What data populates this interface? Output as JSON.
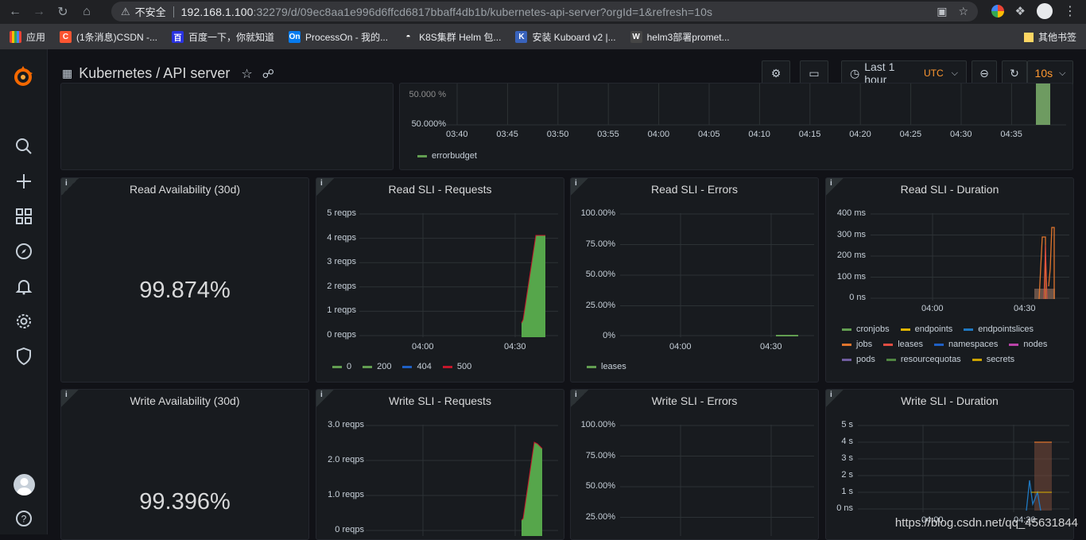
{
  "browser": {
    "insecure_label": "不安全",
    "url_host": "192.168.1.100",
    "url_rest": ":32279/d/09ec8aa1e996d6ffcd6817bbaff4db1b/kubernetes-api-server?orgId=1&refresh=10s",
    "bookmarks": [
      {
        "label": "应用",
        "icon": "apps-grid-icon",
        "color": "#ea4335"
      },
      {
        "label": "(1条消息)CSDN -...",
        "icon": "csdn-icon",
        "color": "#fc5531",
        "glyph": "C"
      },
      {
        "label": "百度一下，你就知道",
        "icon": "baidu-icon",
        "color": "#2932e1",
        "glyph": "百"
      },
      {
        "label": "ProcessOn - 我的...",
        "icon": "processon-icon",
        "color": "#067bef",
        "glyph": "On"
      },
      {
        "label": "K8S集群 Helm 包...",
        "icon": "github-icon",
        "color": "#35363a",
        "glyph": "◓"
      },
      {
        "label": "安装 Kuboard v2 |...",
        "icon": "kuboard-icon",
        "color": "#3963bc",
        "glyph": "K"
      },
      {
        "label": "helm3部署promet...",
        "icon": "wordpress-icon",
        "color": "#464646",
        "glyph": "W"
      }
    ],
    "other_bookmarks": "其他书签"
  },
  "dashboard": {
    "title": "Kubernetes / API server",
    "time_range": "Last 1 hour",
    "timezone": "UTC",
    "refresh": "10s"
  },
  "panels": {
    "errorbudget": {
      "ytick": "50.000%",
      "ytick_partial": "50.000 %",
      "xticks": [
        "03:40",
        "03:45",
        "03:50",
        "03:55",
        "04:00",
        "04:05",
        "04:10",
        "04:15",
        "04:20",
        "04:25",
        "04:30",
        "04:35"
      ],
      "legend": [
        {
          "name": "errorbudget",
          "color": "#629e51"
        }
      ]
    },
    "read_availability": {
      "title": "Read Availability (30d)",
      "value": "99.874%"
    },
    "write_availability": {
      "title": "Write Availability (30d)",
      "value": "99.396%"
    },
    "read_requests": {
      "title": "Read SLI - Requests",
      "yticks": [
        "5 reqps",
        "4 reqps",
        "3 reqps",
        "2 reqps",
        "1 reqps",
        "0 reqps"
      ],
      "xticks": [
        "04:00",
        "04:30"
      ],
      "legend": [
        {
          "name": "0",
          "color": "#629e51"
        },
        {
          "name": "200",
          "color": "#629e51"
        },
        {
          "name": "404",
          "color": "#1f60c4"
        },
        {
          "name": "500",
          "color": "#c4162a"
        }
      ]
    },
    "read_errors": {
      "title": "Read SLI - Errors",
      "yticks": [
        "100.00%",
        "75.00%",
        "50.00%",
        "25.00%",
        "0%"
      ],
      "xticks": [
        "04:00",
        "04:30"
      ],
      "legend": [
        {
          "name": "leases",
          "color": "#629e51"
        }
      ]
    },
    "read_duration": {
      "title": "Read SLI - Duration",
      "yticks": [
        "400 ms",
        "300 ms",
        "200 ms",
        "100 ms",
        "0 ns"
      ],
      "xticks": [
        "04:00",
        "04:30"
      ],
      "legend": [
        {
          "name": "cronjobs",
          "color": "#629e51"
        },
        {
          "name": "endpoints",
          "color": "#e0b400"
        },
        {
          "name": "endpointslices",
          "color": "#1f78c1"
        },
        {
          "name": "jobs",
          "color": "#e0752d"
        },
        {
          "name": "leases",
          "color": "#e24d42"
        },
        {
          "name": "namespaces",
          "color": "#1f60c4"
        },
        {
          "name": "nodes",
          "color": "#ba43a9"
        },
        {
          "name": "pods",
          "color": "#705da0"
        },
        {
          "name": "resourcequotas",
          "color": "#508642"
        },
        {
          "name": "secrets",
          "color": "#cca300"
        }
      ]
    },
    "write_requests": {
      "title": "Write SLI - Requests",
      "yticks": [
        "3.0 reqps",
        "2.0 reqps",
        "1.0 reqps",
        "0 reqps"
      ]
    },
    "write_errors": {
      "title": "Write SLI - Errors",
      "yticks": [
        "100.00%",
        "75.00%",
        "50.00%",
        "25.00%"
      ]
    },
    "write_duration": {
      "title": "Write SLI - Duration",
      "yticks": [
        "5 s",
        "4 s",
        "3 s",
        "2 s",
        "1 s",
        "0 ns"
      ],
      "xticks": [
        "04:00",
        "04:30"
      ]
    }
  },
  "watermark": "https://blog.csdn.net/qq_45631844",
  "chart_data": [
    {
      "type": "area",
      "title": "Read SLI - Requests",
      "series": [
        {
          "name": "200",
          "points": [
            [
              0.9,
              0.6
            ],
            [
              0.95,
              4.1
            ],
            [
              1.0,
              4.1
            ]
          ]
        }
      ]
    },
    {
      "type": "area",
      "title": "Write SLI - Requests",
      "series": [
        {
          "name": "200",
          "points": [
            [
              0.9,
              0.3
            ],
            [
              0.95,
              2.5
            ],
            [
              1.0,
              2.4
            ]
          ]
        }
      ]
    }
  ]
}
